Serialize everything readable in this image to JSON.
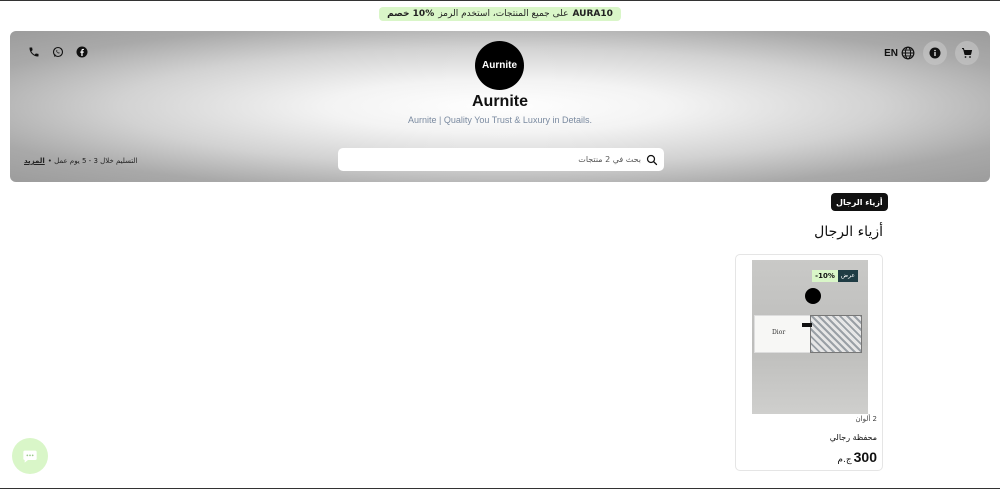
{
  "promo": {
    "code": "AURA10",
    "text": "على جميع المنتجات، استخدم الرمز",
    "discount": "10% خصم"
  },
  "header": {
    "language": "EN",
    "store_name": "Aurnite",
    "tagline": "Aurnite | Quality You Trust & Luxury in Details.",
    "logo_text": "Aurnite",
    "delivery_text": "التسليم خلال 3 - 5 يوم عمل •",
    "delivery_more": "المزيد",
    "search_placeholder": "بحث في 2 منتجات"
  },
  "category": {
    "chip_label": "أزياء الرجال",
    "section_title": "أزياء الرجال"
  },
  "products": [
    {
      "name": "محفظة رجالي",
      "colors": "2 ألوان",
      "price": "300",
      "currency": "ج.م",
      "offer_label": "عرض",
      "discount": "-10%",
      "photo_brand": "Dior"
    }
  ],
  "colors": {
    "promo_bg": "#d9f6c8",
    "chip_bg": "#111111",
    "offer_bg": "#1f3c44"
  },
  "icons": [
    "phone-icon",
    "whatsapp-icon",
    "facebook-icon",
    "globe-icon",
    "info-icon",
    "cart-icon",
    "search-icon",
    "chat-icon"
  ]
}
